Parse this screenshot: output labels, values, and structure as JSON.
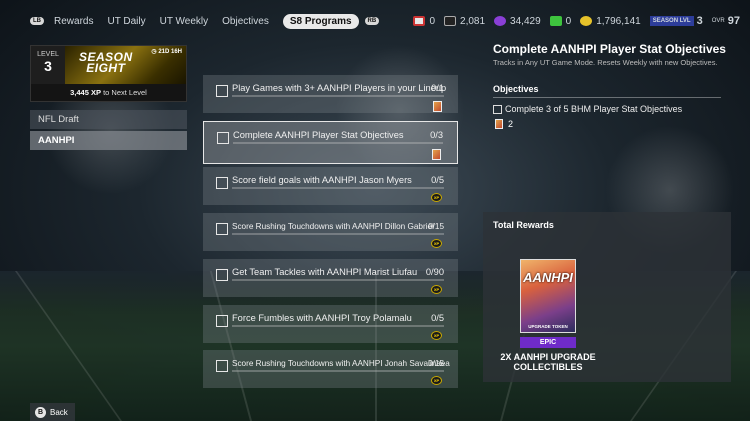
{
  "topbar": {
    "lb": "LB",
    "rb": "RB",
    "tabs": [
      "Rewards",
      "UT Daily",
      "UT Weekly",
      "Objectives",
      "S8 Programs"
    ],
    "active_tab": "S8 Programs"
  },
  "currencies": {
    "c1": "0",
    "c2": "2,081",
    "c3": "34,429",
    "c4": "0",
    "coins": "1,796,141",
    "season_lvl_label": "SEASON LVL",
    "season_lvl": "3",
    "ovr_label": "OVR",
    "ovr": "97"
  },
  "season": {
    "level_label": "LEVEL",
    "level": "3",
    "title": "SEASON\nEIGHT",
    "timer": "21D 16H",
    "xp_value": "3,445 XP",
    "xp_suffix": "to Next Level"
  },
  "nav": {
    "items": [
      "NFL Draft",
      "AANHPI"
    ],
    "selected": "AANHPI"
  },
  "objectives": [
    {
      "text": "Play Games with 3+ AANHPI Players in your Lineup",
      "count": "0/1",
      "reward": "pack"
    },
    {
      "text": "Complete AANHPI Player Stat Objectives",
      "count": "0/3",
      "reward": "pack"
    },
    {
      "text": "Score field goals with AANHPI Jason Myers",
      "count": "0/5",
      "reward": "xp"
    },
    {
      "text": "Score Rushing Touchdowns with AANHPI Dillon Gabriel",
      "count": "0/15",
      "reward": "xp"
    },
    {
      "text": "Get Team Tackles with AANHPI Marist Liufau",
      "count": "0/90",
      "reward": "xp"
    },
    {
      "text": "Force Fumbles with AANHPI Troy Polamalu",
      "count": "0/5",
      "reward": "xp"
    },
    {
      "text": "Score Rushing Touchdowns with AANHPI Jonah Savaiinaea",
      "count": "0/15",
      "reward": "xp"
    }
  ],
  "detail": {
    "title": "Complete AANHPI Player Stat Objectives",
    "subtitle": "Tracks in Any UT Game Mode. Resets Weekly with new Objectives.",
    "objectives_header": "Objectives",
    "sub_objective": "Complete 3 of 5 BHM Player Stat Objectives",
    "sub_reward_count": "2"
  },
  "rewards": {
    "header": "Total Rewards",
    "card_word": "AANHPI",
    "card_sub": "UPGRADE TOKEN",
    "rarity": "EPIC",
    "name": "2X AANHPI UPGRADE COLLECTIBLES"
  },
  "back": {
    "button": "B",
    "label": "Back"
  }
}
